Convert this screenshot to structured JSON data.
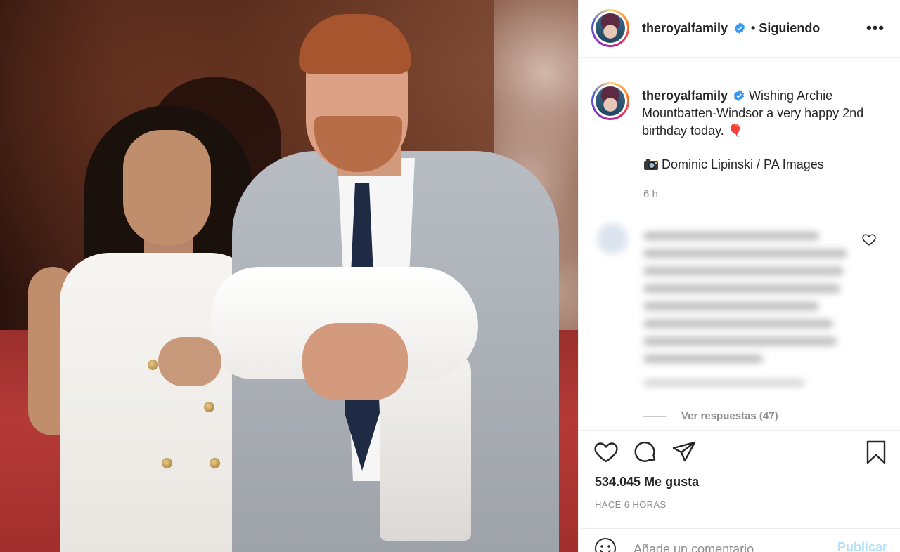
{
  "post": {
    "username": "theroyalfamily",
    "follow_status": "Siguiendo",
    "more_label": "•••",
    "caption": "Wishing Archie Mountbatten-Windsor a very happy 2nd birthday today. 🎈",
    "photo_credit": "Dominic Lipinski / PA Images",
    "caption_time": "6 h",
    "view_replies": "Ver respuestas (47)",
    "likes": "534.045 Me gusta",
    "posted_time": "HACE 6 HORAS",
    "comment_placeholder": "Añade un comentario...",
    "publish_label": "Publicar"
  },
  "icons": {
    "verified": "verified-badge-icon",
    "like": "heart-icon",
    "comment": "comment-bubble-icon",
    "share": "paper-plane-icon",
    "save": "bookmark-icon",
    "emoji": "smiley-icon",
    "camera": "camera-emoji"
  },
  "colors": {
    "verified_blue": "#3897f0",
    "publish_disabled": "#b2dffc",
    "muted_text": "#8e8e8e",
    "text": "#262626"
  }
}
